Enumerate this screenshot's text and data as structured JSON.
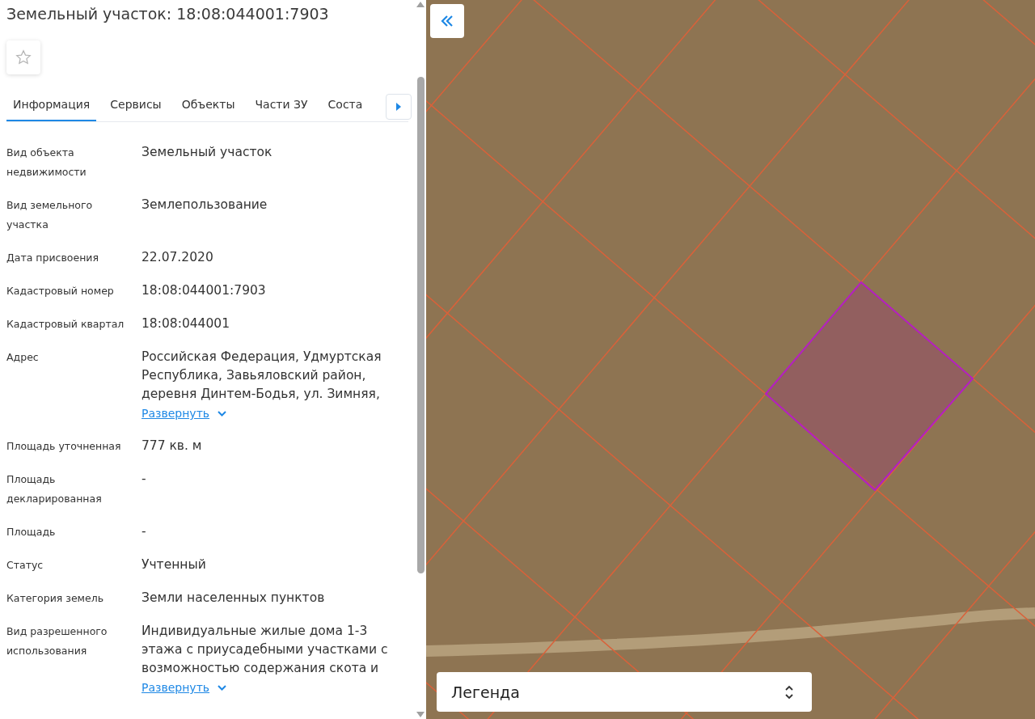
{
  "title": "Земельный участок: 18:08:044001:7903",
  "tabs": [
    {
      "label": "Информация",
      "selected": true
    },
    {
      "label": "Сервисы",
      "selected": false
    },
    {
      "label": "Объекты",
      "selected": false
    },
    {
      "label": "Части ЗУ",
      "selected": false
    },
    {
      "label": "Соста",
      "selected": false
    }
  ],
  "fields": [
    {
      "label": "Вид объекта недвижимости",
      "value": "Земельный участок"
    },
    {
      "label": "Вид земельного участка",
      "value": "Землепользование"
    },
    {
      "label": "Дата присвоения",
      "value": "22.07.2020"
    },
    {
      "label": "Кадастровый номер",
      "value": "18:08:044001:7903"
    },
    {
      "label": "Кадастровый квартал",
      "value": "18:08:044001"
    },
    {
      "label": "Адрес",
      "value": "Российская Федерация, Удмуртская Республика, Завьяловский район, деревня Динтем-Бодья, ул. Зимняя,",
      "expand_link": "Развернуть"
    },
    {
      "label": "Площадь уточненная",
      "value": "777 кв. м"
    },
    {
      "label": "Площадь декларированная",
      "value": "-"
    },
    {
      "label": "Площадь",
      "value": "-"
    },
    {
      "label": "Статус",
      "value": "Учтенный"
    },
    {
      "label": "Категория земель",
      "value": "Земли населенных пунктов"
    },
    {
      "label": "Вид разрешенного использования",
      "value": "Индивидуальные жилые дома 1-3 этажа с приусадебными участками с возможностью содержания скота и",
      "expand_link": "Развернуть"
    }
  ],
  "legend": {
    "label": "Легенда"
  }
}
